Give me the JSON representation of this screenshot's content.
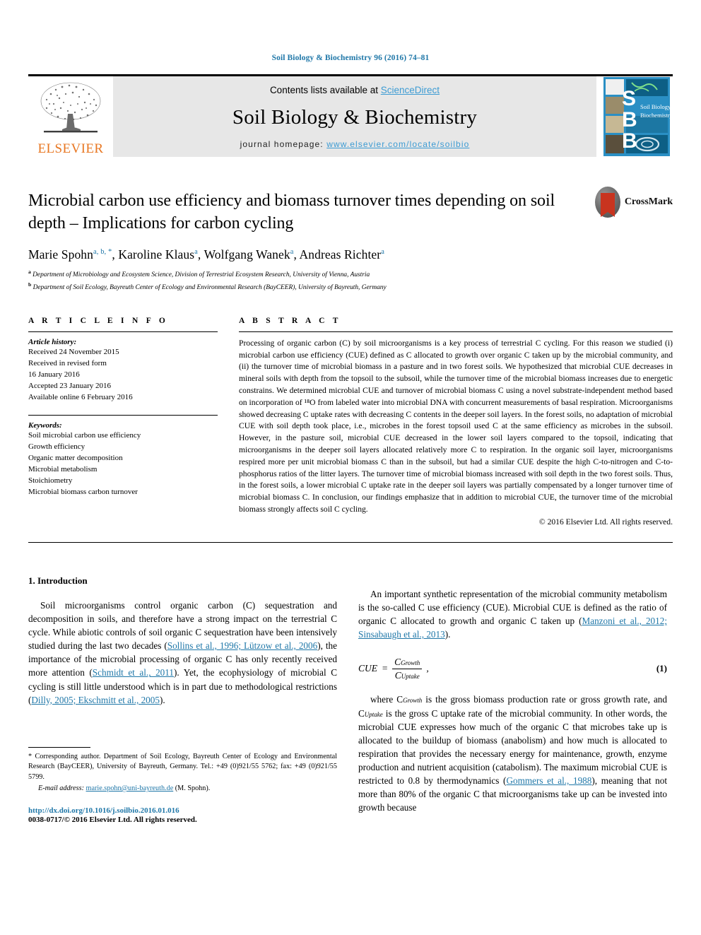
{
  "running_head": "Soil Biology & Biochemistry 96 (2016) 74–81",
  "masthead": {
    "contents_prefix": "Contents lists available at ",
    "sciencedirect": "ScienceDirect",
    "journal_name": "Soil Biology & Biochemistry",
    "homepage_label": "journal homepage: ",
    "homepage_url": "www.elsevier.com/locate/soilbio",
    "elsevier_wordmark": "ELSEVIER",
    "cover_title_line1": "Soil Biology &",
    "cover_title_line2": "Biochemistry",
    "cover_letters": "SBB"
  },
  "article": {
    "title": "Microbial carbon use efficiency and biomass turnover times depending on soil depth – Implications for carbon cycling",
    "crossmark_label": "CrossMark",
    "authors": [
      {
        "name": "Marie Spohn",
        "marks": "a, b, *"
      },
      {
        "name": "Karoline Klaus",
        "marks": "a"
      },
      {
        "name": "Wolfgang Wanek",
        "marks": "a"
      },
      {
        "name": "Andreas Richter",
        "marks": "a"
      }
    ],
    "affiliations": [
      {
        "mark": "a",
        "text": "Department of Microbiology and Ecosystem Science, Division of Terrestrial Ecosystem Research, University of Vienna, Austria"
      },
      {
        "mark": "b",
        "text": "Department of Soil Ecology, Bayreuth Center of Ecology and Environmental Research (BayCEER), University of Bayreuth, Germany"
      }
    ]
  },
  "article_info": {
    "heading": "A R T I C L E   I N F O",
    "history_label": "Article history:",
    "history": [
      "Received 24 November 2015",
      "Received in revised form",
      "16 January 2016",
      "Accepted 23 January 2016",
      "Available online 6 February 2016"
    ],
    "keywords_label": "Keywords:",
    "keywords": [
      "Soil microbial carbon use efficiency",
      "Growth efficiency",
      "Organic matter decomposition",
      "Microbial metabolism",
      "Stoichiometry",
      "Microbial biomass carbon turnover"
    ]
  },
  "abstract": {
    "heading": "A B S T R A C T",
    "text": "Processing of organic carbon (C) by soil microorganisms is a key process of terrestrial C cycling. For this reason we studied (i) microbial carbon use efficiency (CUE) defined as C allocated to growth over organic C taken up by the microbial community, and (ii) the turnover time of microbial biomass in a pasture and in two forest soils. We hypothesized that microbial CUE decreases in mineral soils with depth from the topsoil to the subsoil, while the turnover time of the microbial biomass increases due to energetic constrains. We determined microbial CUE and turnover of microbial biomass C using a novel substrate-independent method based on incorporation of ¹⁸O from labeled water into microbial DNA with concurrent measurements of basal respiration. Microorganisms showed decreasing C uptake rates with decreasing C contents in the deeper soil layers. In the forest soils, no adaptation of microbial CUE with soil depth took place, i.e., microbes in the forest topsoil used C at the same efficiency as microbes in the subsoil. However, in the pasture soil, microbial CUE decreased in the lower soil layers compared to the topsoil, indicating that microorganisms in the deeper soil layers allocated relatively more C to respiration. In the organic soil layer, microorganisms respired more per unit microbial biomass C than in the subsoil, but had a similar CUE despite the high C-to-nitrogen and C-to-phosphorus ratios of the litter layers. The turnover time of microbial biomass increased with soil depth in the two forest soils. Thus, in the forest soils, a lower microbial C uptake rate in the deeper soil layers was partially compensated by a longer turnover time of microbial biomass C. In conclusion, our findings emphasize that in addition to microbial CUE, the turnover time of the microbial biomass strongly affects soil C cycling.",
    "copyright": "© 2016 Elsevier Ltd. All rights reserved."
  },
  "body": {
    "section1_heading": "1. Introduction",
    "left_para1_a": "Soil microorganisms control organic carbon (C) sequestration and decomposition in soils, and therefore have a strong impact on the terrestrial C cycle. While abiotic controls of soil organic C sequestration have been intensively studied during the last two decades (",
    "left_para1_ref1": "Sollins et al., 1996; Lützow et al., 2006",
    "left_para1_b": "), the importance of the microbial processing of organic C has only recently received more attention (",
    "left_para1_ref2": "Schmidt et al., 2011",
    "left_para1_c": "). Yet, the ecophysiology of microbial C cycling is still little understood which is in part due to methodological restrictions (",
    "left_para1_ref3": "Dilly, 2005; Ekschmitt et al., 2005",
    "left_para1_d": ").",
    "right_para1_a": "An important synthetic representation of the microbial community metabolism is the so-called C use efficiency (CUE). Microbial CUE is defined as the ratio of organic C allocated to growth and organic C taken up (",
    "right_para1_ref1": "Manzoni et al., 2012; Sinsabaugh et al., 2013",
    "right_para1_b": ").",
    "equation": {
      "lhs": "CUE",
      "equals": "=",
      "numerator_main": "C",
      "numerator_sub": "Growth",
      "denominator_main": "C",
      "denominator_sub": "Uptake",
      "comma": ",",
      "number": "(1)"
    },
    "right_para2_a": "where C",
    "right_para2_sub1": "Growth",
    "right_para2_b": " is the gross biomass production rate or gross growth rate, and C",
    "right_para2_sub2": "Uptake",
    "right_para2_c": " is the gross C uptake rate of the microbial community. In other words, the microbial CUE expresses how much of the organic C that microbes take up is allocated to the buildup of biomass (anabolism) and how much is allocated to respiration that provides the necessary energy for maintenance, growth, enzyme production and nutrient acquisition (catabolism). The maximum microbial CUE is restricted to 0.8 by thermodynamics (",
    "right_para2_ref1": "Gommers et al., 1988",
    "right_para2_d": "), meaning that not more than 80% of the organic C that microorganisms take up can be invested into growth because"
  },
  "footer": {
    "corresponding_marker": "*",
    "corresponding_text": " Corresponding author. Department of Soil Ecology, Bayreuth Center of Ecology and Environmental Research (BayCEER), University of Bayreuth, Germany. Tel.: +49 (0)921/55 5762; fax: +49 (0)921/55 5799.",
    "email_label": "E-mail address: ",
    "email": "marie.spohn@uni-bayreuth.de",
    "email_suffix": " (M. Spohn).",
    "doi": "http://dx.doi.org/10.1016/j.soilbio.2016.01.016",
    "issn_line": "0038-0717/© 2016 Elsevier Ltd. All rights reserved."
  },
  "colors": {
    "link_blue": "#1f77a8",
    "sciencedirect_blue": "#3c9bd3",
    "elsevier_orange": "#E87722",
    "cover_blue": "#2a8fc4",
    "band_gray": "#e7e7e7"
  }
}
